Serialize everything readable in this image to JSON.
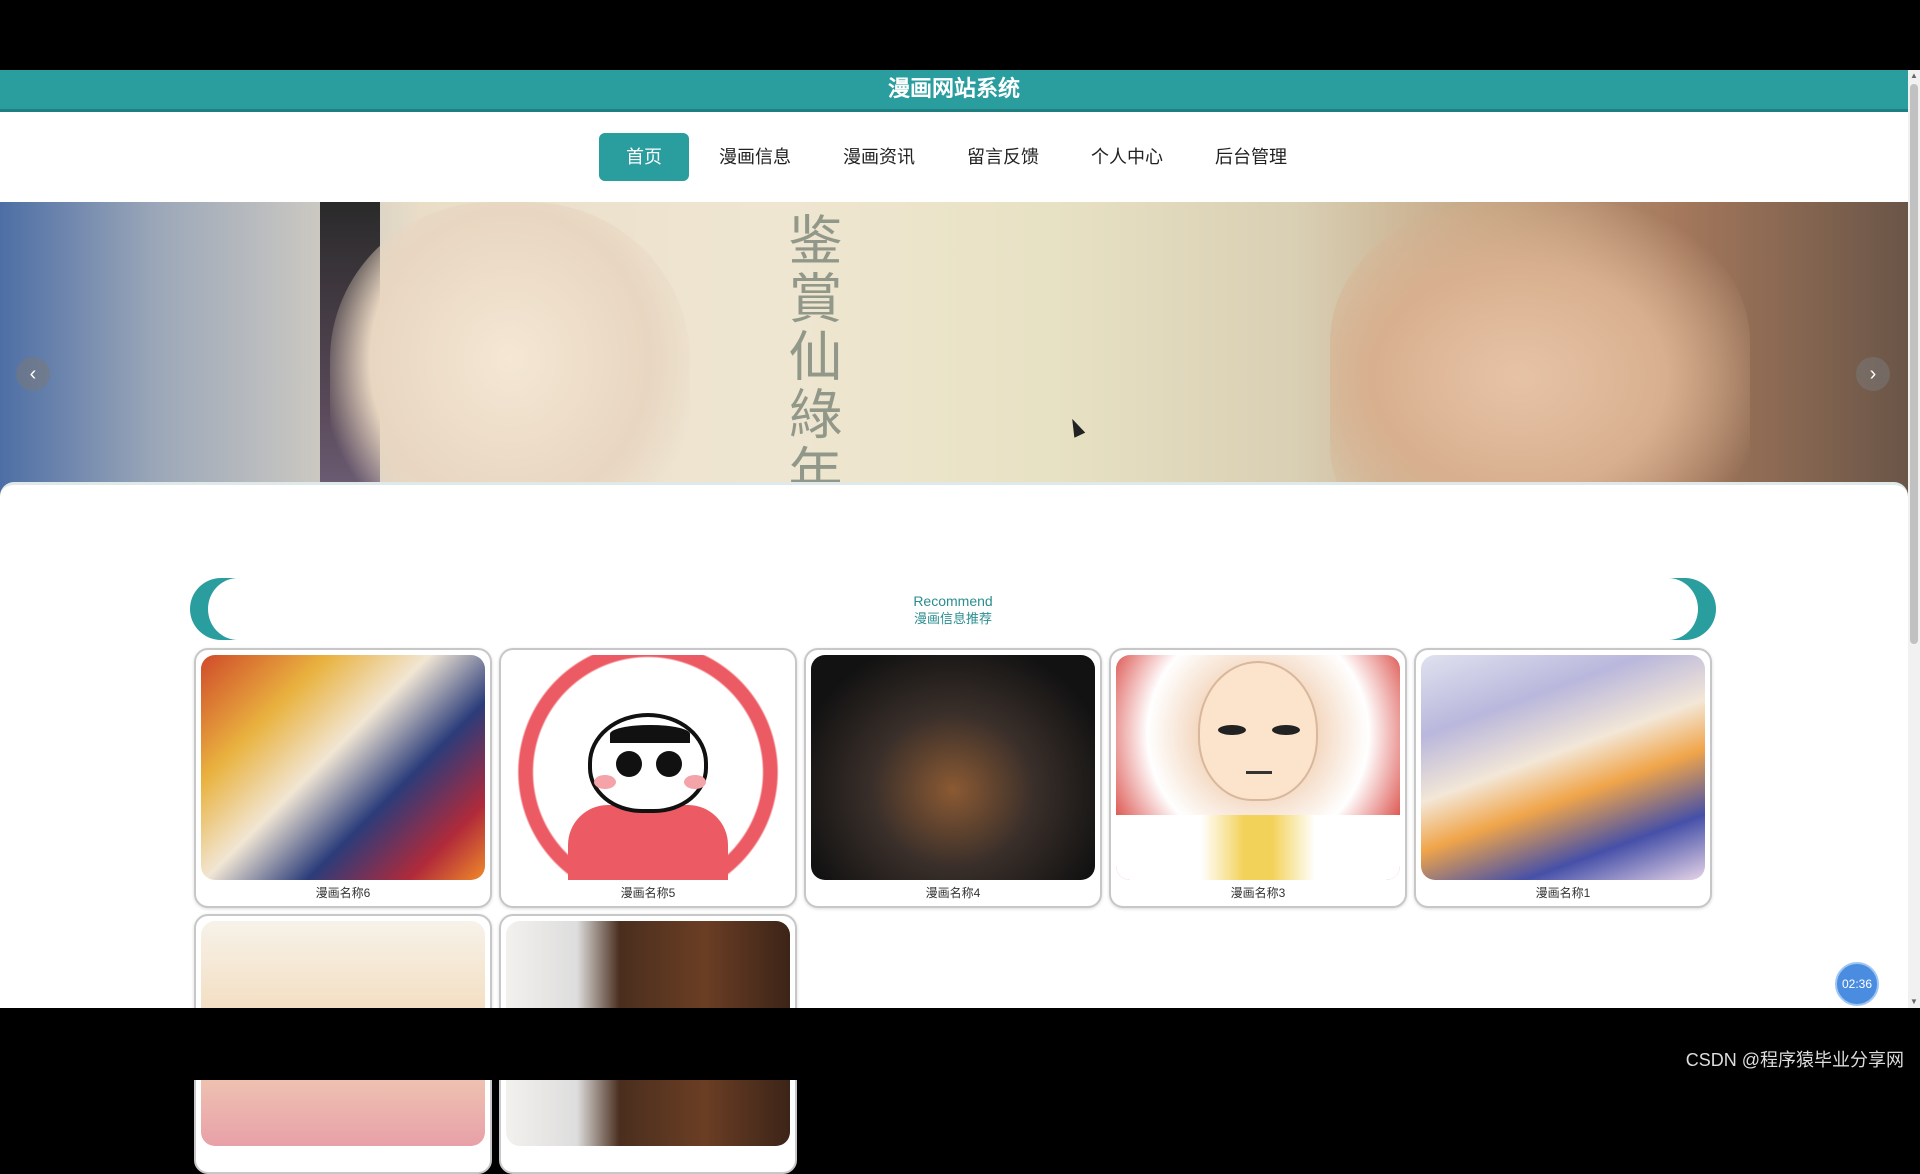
{
  "site": {
    "title": "漫画网站系统"
  },
  "nav": {
    "items": [
      {
        "label": "首页",
        "active": true
      },
      {
        "label": "漫画信息",
        "active": false
      },
      {
        "label": "漫画资讯",
        "active": false
      },
      {
        "label": "留言反馈",
        "active": false
      },
      {
        "label": "个人中心",
        "active": false
      },
      {
        "label": "后台管理",
        "active": false
      }
    ]
  },
  "banner": {
    "calligraphy": "鉴賞仙綠年",
    "prev_icon": "‹",
    "next_icon": "›",
    "slides": 3,
    "active_slide": 1
  },
  "recommend": {
    "en": "Recommend",
    "cn": "漫画信息推荐"
  },
  "cards": [
    {
      "name": "漫画名称6"
    },
    {
      "name": "漫画名称5"
    },
    {
      "name": "漫画名称4"
    },
    {
      "name": "漫画名称3"
    },
    {
      "name": "漫画名称1"
    },
    {
      "name": ""
    },
    {
      "name": ""
    }
  ],
  "timer": {
    "label": "02:36"
  },
  "watermark": {
    "text": "CSDN @程序猿毕业分享网"
  },
  "colors": {
    "accent": "#2a9d9f",
    "dot_active": "#1f6f86",
    "dot": "#e0404e"
  }
}
